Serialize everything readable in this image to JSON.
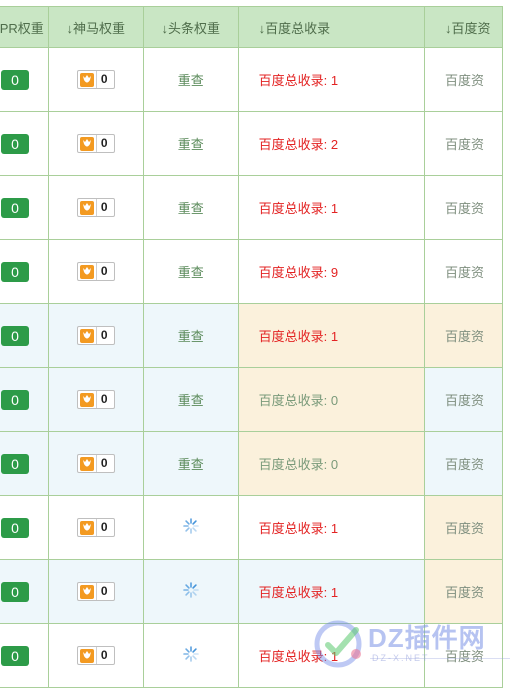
{
  "headers": [
    {
      "label": "PR权重"
    },
    {
      "label": "↓神马权重"
    },
    {
      "label": "↓头条权重"
    },
    {
      "label": "↓百度总收录"
    },
    {
      "label": "↓百度资"
    }
  ],
  "rows": [
    {
      "pr": "0",
      "shenma": "0",
      "toutiao": "重查",
      "toutiao_type": "text",
      "baidu": "百度总收录: 1",
      "baidu_color": "red",
      "next": "百度资",
      "highlight": false,
      "warm_baidu": false,
      "warm_next": false
    },
    {
      "pr": "0",
      "shenma": "0",
      "toutiao": "重查",
      "toutiao_type": "text",
      "baidu": "百度总收录: 2",
      "baidu_color": "red",
      "next": "百度资",
      "highlight": false,
      "warm_baidu": false,
      "warm_next": false
    },
    {
      "pr": "0",
      "shenma": "0",
      "toutiao": "重查",
      "toutiao_type": "text",
      "baidu": "百度总收录: 1",
      "baidu_color": "red",
      "next": "百度资",
      "highlight": false,
      "warm_baidu": false,
      "warm_next": false
    },
    {
      "pr": "0",
      "shenma": "0",
      "toutiao": "重查",
      "toutiao_type": "text",
      "baidu": "百度总收录: 9",
      "baidu_color": "red",
      "next": "百度资",
      "highlight": false,
      "warm_baidu": false,
      "warm_next": false
    },
    {
      "pr": "0",
      "shenma": "0",
      "toutiao": "重查",
      "toutiao_type": "text",
      "baidu": "百度总收录: 1",
      "baidu_color": "red",
      "next": "百度资",
      "highlight": true,
      "warm_baidu": true,
      "warm_next": true
    },
    {
      "pr": "0",
      "shenma": "0",
      "toutiao": "重查",
      "toutiao_type": "text",
      "baidu": "百度总收录: 0",
      "baidu_color": "green",
      "next": "百度资",
      "highlight": true,
      "warm_baidu": true,
      "warm_next": false
    },
    {
      "pr": "0",
      "shenma": "0",
      "toutiao": "重查",
      "toutiao_type": "text",
      "baidu": "百度总收录: 0",
      "baidu_color": "green",
      "next": "百度资",
      "highlight": true,
      "warm_baidu": true,
      "warm_next": false
    },
    {
      "pr": "0",
      "shenma": "0",
      "toutiao": "",
      "toutiao_type": "spinner",
      "baidu": "百度总收录: 1",
      "baidu_color": "red",
      "next": "百度资",
      "highlight": false,
      "warm_baidu": false,
      "warm_next": true
    },
    {
      "pr": "0",
      "shenma": "0",
      "toutiao": "",
      "toutiao_type": "spinner",
      "baidu": "百度总收录: 1",
      "baidu_color": "red",
      "next": "百度资",
      "highlight": true,
      "warm_baidu": false,
      "warm_next": true
    },
    {
      "pr": "0",
      "shenma": "0",
      "toutiao": "",
      "toutiao_type": "spinner",
      "baidu": "百度总收录: 1",
      "baidu_color": "red",
      "next": "百度资",
      "highlight": false,
      "warm_baidu": false,
      "warm_next": false
    }
  ],
  "watermark": {
    "text": "DZ插件网",
    "sub": "DZ-X.NET"
  },
  "colors": {
    "header_bg": "#c9e6c4",
    "border": "#a9cf9a",
    "pr_badge": "#2d9b48",
    "red": "#e32323",
    "highlight_row": "#eef7fb",
    "warm_cell": "#fbf1dc"
  }
}
